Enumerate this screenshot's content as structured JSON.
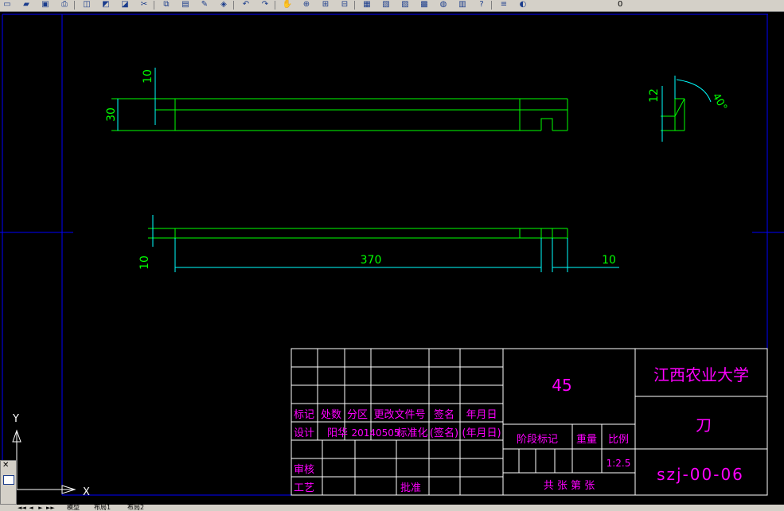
{
  "toolbar": {
    "icons": [
      "new-icon",
      "open-icon",
      "save-icon",
      "print-icon",
      "preview-icon",
      "publish-icon",
      "plot-icon",
      "cut-icon",
      "copy-icon",
      "paste-icon",
      "matchprop-icon",
      "blockeditor-icon",
      "undo-icon",
      "redo-icon",
      "pan-icon",
      "zoom-realtime-icon",
      "zoom-window-icon",
      "zoom-previous-icon",
      "properties-icon",
      "designcenter-icon",
      "toolpalettes-icon",
      "sheetset-icon",
      "markup-icon",
      "calculator-icon",
      "help-icon",
      "layer-manager-icon",
      "layer-state-icon"
    ],
    "layer_value": "0",
    "colors": {
      "face": "#d4d0c8",
      "icon": "#1a3c8c"
    }
  },
  "drawing": {
    "background": "#000000",
    "colors": {
      "geometry": "#00ff00",
      "dimension": "#00ffff",
      "frame": "#0000ff",
      "titleblock_lines": "#ffffff",
      "titleblock_text": "#ff00ff"
    },
    "top_view_dims": {
      "height_total": "30",
      "slot_depth": "10"
    },
    "side_view_dims": {
      "height": "12",
      "angle": "40°"
    },
    "front_view_dims": {
      "thickness": "10",
      "length": "370",
      "end": "10"
    },
    "ucs": {
      "x_label": "X",
      "y_label": "Y"
    }
  },
  "title_block": {
    "material": "45",
    "school": "江西农业大学",
    "part_name": "刀",
    "drawing_no": "szj-00-06",
    "header_row": [
      "标记",
      "处数",
      "分区",
      "更改文件号",
      "签名",
      "年月日"
    ],
    "design_row": [
      "设计",
      "阳华",
      "20140505",
      "标准化",
      "(签名)",
      "(年月日)"
    ],
    "stage_label": "阶段标记",
    "weight_label": "重量",
    "scale_label": "比例",
    "scale_value": "1:2.5",
    "review_label": "审核",
    "process_label": "工艺",
    "approve_label": "批准",
    "sheets_text": "共 张 第 张"
  },
  "status": {
    "tabs": [
      "模型",
      "布局1",
      "布局2"
    ],
    "nav": [
      "◄◄",
      "◄",
      "►",
      "►►"
    ]
  }
}
